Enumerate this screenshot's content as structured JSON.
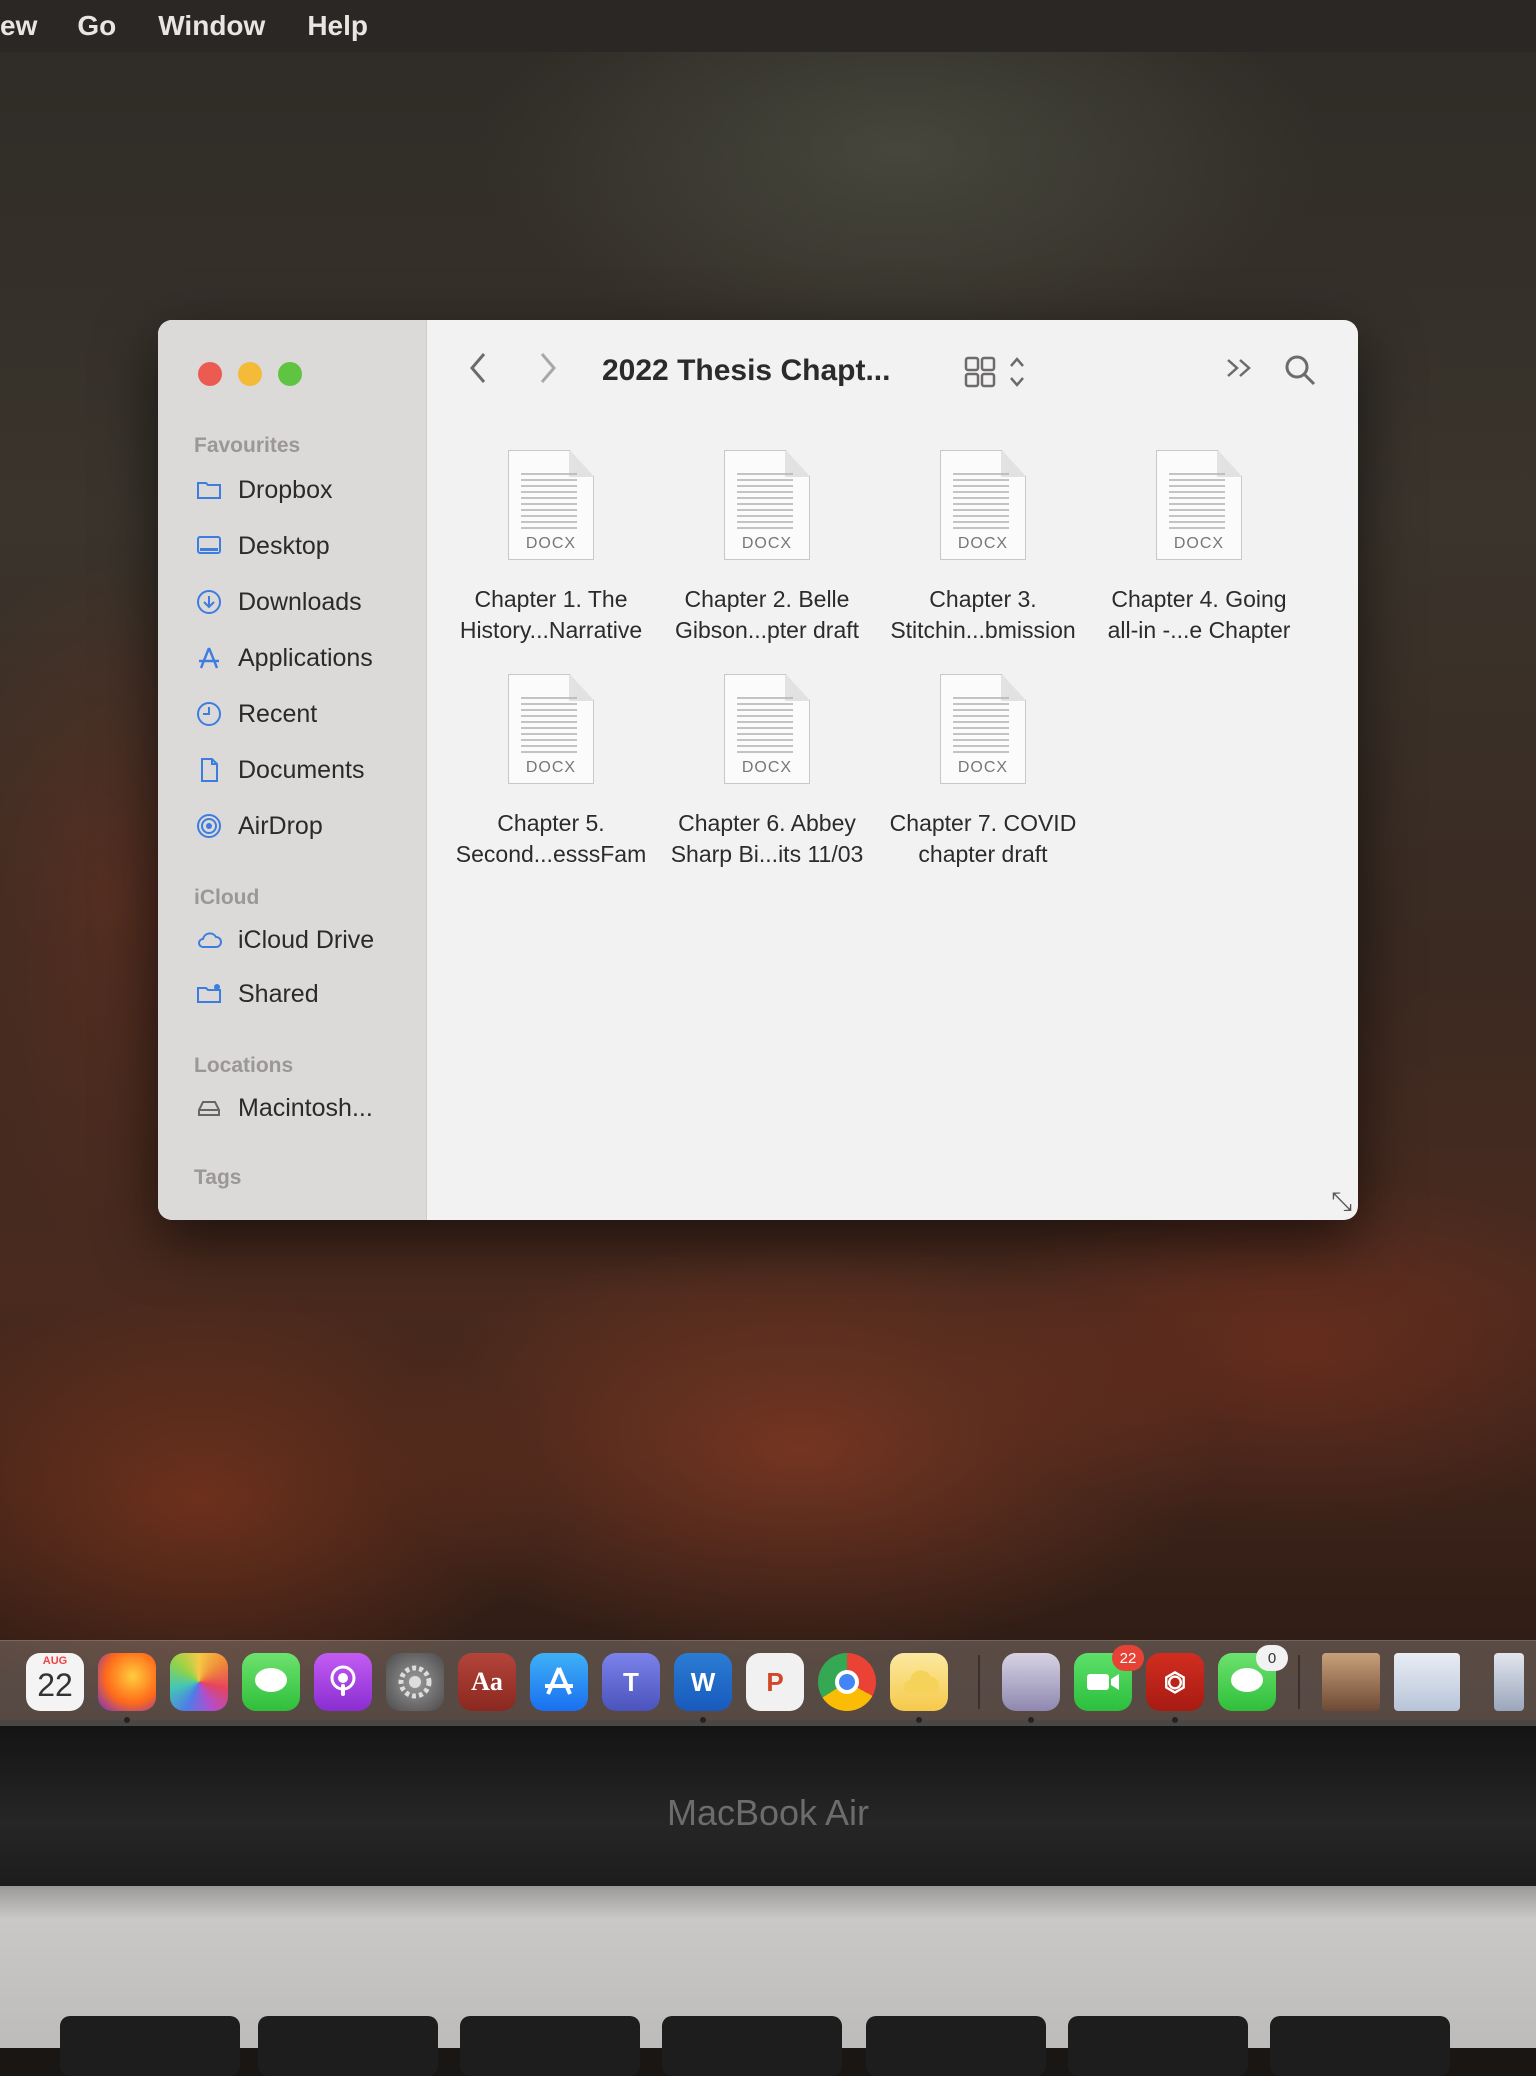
{
  "menubar": {
    "items": [
      "ew",
      "Go",
      "Window",
      "Help"
    ]
  },
  "window": {
    "title": "2022 Thesis Chapt...",
    "sidebar": {
      "sections": {
        "favourites": "Favourites",
        "icloud": "iCloud",
        "locations": "Locations",
        "tags": "Tags"
      },
      "favourites": [
        {
          "label": "Dropbox",
          "icon": "folder-icon"
        },
        {
          "label": "Desktop",
          "icon": "desktop-icon"
        },
        {
          "label": "Downloads",
          "icon": "download-icon"
        },
        {
          "label": "Applications",
          "icon": "applications-icon"
        },
        {
          "label": "Recent",
          "icon": "clock-icon"
        },
        {
          "label": "Documents",
          "icon": "document-icon"
        },
        {
          "label": "AirDrop",
          "icon": "airdrop-icon"
        }
      ],
      "icloud": [
        {
          "label": "iCloud Drive",
          "icon": "cloud-icon"
        },
        {
          "label": "Shared",
          "icon": "shared-folder-icon"
        }
      ],
      "locations": [
        {
          "label": "Macintosh...",
          "icon": "disk-icon"
        }
      ]
    },
    "files": [
      {
        "line1": "Chapter 1. The",
        "line2": "History...Narrative",
        "kind": "DOCX"
      },
      {
        "line1": "Chapter 2. Belle",
        "line2": "Gibson...pter draft",
        "kind": "DOCX"
      },
      {
        "line1": "Chapter 3.",
        "line2": "Stitchin...bmission",
        "kind": "DOCX"
      },
      {
        "line1": "Chapter 4. Going",
        "line2": "all-in -...e Chapter",
        "kind": "DOCX"
      },
      {
        "line1": "Chapter 5.",
        "line2": "Second...esssFam",
        "kind": "DOCX"
      },
      {
        "line1": "Chapter 6. Abbey",
        "line2": "Sharp Bi...its 11/03",
        "kind": "DOCX"
      },
      {
        "line1": "Chapter 7. COVID",
        "line2": "chapter draft",
        "kind": "DOCX"
      }
    ]
  },
  "dock": {
    "calendar": {
      "month": "AUG",
      "day": "22"
    },
    "apps": [
      "Firefox",
      "Photos",
      "Messages",
      "Podcasts",
      "System Preferences",
      "Dictionary",
      "App Store",
      "Teams",
      "Word",
      "PowerPoint",
      "Chrome",
      "Weather",
      "Preview",
      "FaceTime",
      "Acrobat",
      "Messages"
    ],
    "facetime_badge": "22",
    "messages_badge": "0",
    "dictionary_glyph": "Aa",
    "word_glyph": "W",
    "powerpoint_glyph": "P"
  },
  "laptop": {
    "brand": "MacBook Air"
  }
}
